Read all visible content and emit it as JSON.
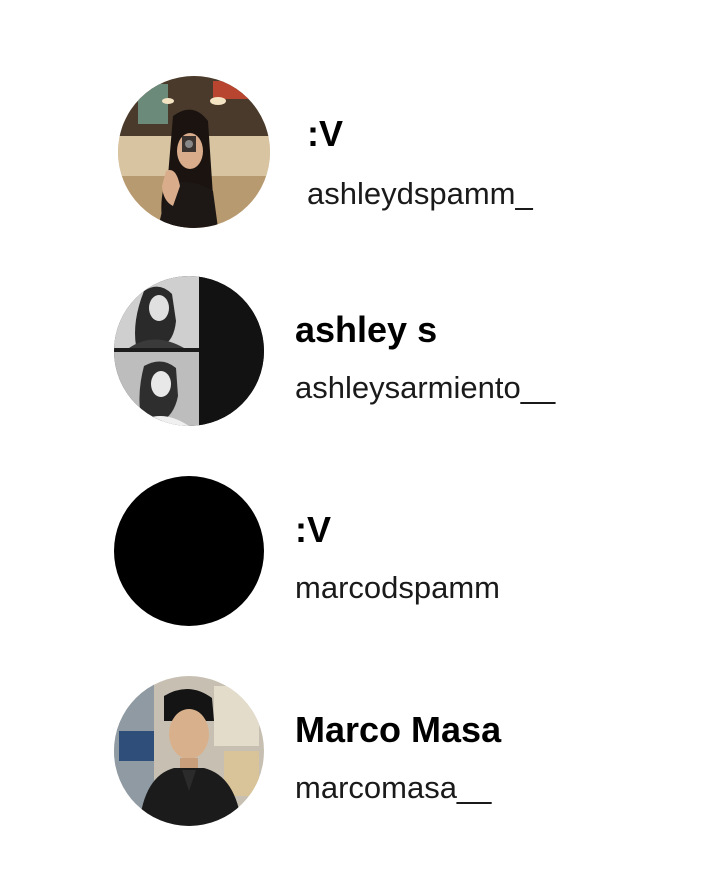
{
  "accounts": [
    {
      "display_name": ":V",
      "username": "ashleydspamm_",
      "avatar": {
        "icon": "profile-photo-icon",
        "kind": "photo",
        "dominant_color": "#8a6a45"
      }
    },
    {
      "display_name": "ashley s",
      "username": "ashleysarmiento__",
      "avatar": {
        "icon": "profile-photo-icon",
        "kind": "photo",
        "dominant_color": "#2a2a2a"
      }
    },
    {
      "display_name": ":V",
      "username": "marcodspamm",
      "avatar": {
        "icon": "profile-photo-icon",
        "kind": "solid",
        "dominant_color": "#000000"
      }
    },
    {
      "display_name": "Marco Masa",
      "username": "marcomasa__",
      "avatar": {
        "icon": "profile-photo-icon",
        "kind": "photo",
        "dominant_color": "#3b342c"
      }
    }
  ]
}
